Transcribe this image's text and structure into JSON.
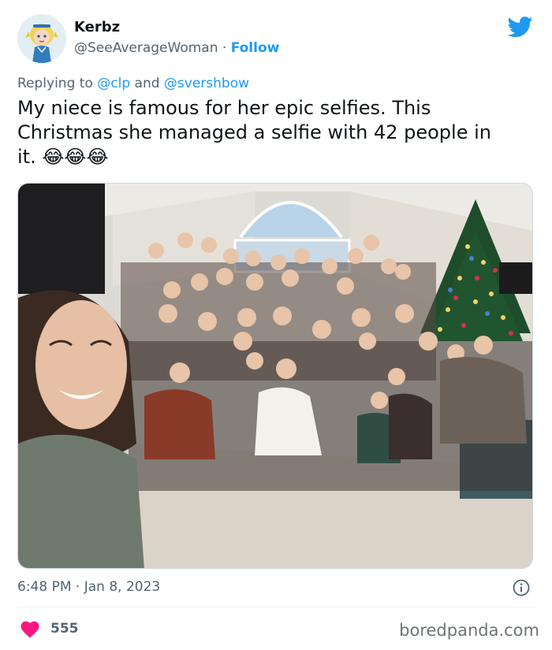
{
  "author": {
    "name": "Kerbz",
    "handle": "@SeeAverageWoman",
    "separator": "·",
    "follow_label": "Follow",
    "avatar_icon": "cartoon-girl-avatar-icon"
  },
  "reply": {
    "prefix": "Replying to",
    "mention1": "@clp",
    "conjunction": "and",
    "mention2": "@svershbow"
  },
  "tweet": {
    "line1": "My niece is famous for her epic selfies. This",
    "line2": "Christmas she managed a selfie with 42 people in",
    "line3": "it.",
    "emoji": "😂😂😂"
  },
  "photo": {
    "icon": "family-selfie-photo"
  },
  "meta": {
    "time": "6:48 PM",
    "separator": "·",
    "date": "Jan 8, 2023",
    "info_icon": "info-icon"
  },
  "engagement": {
    "likes": "555",
    "heart_icon": "heart-icon"
  },
  "watermark": "boredpanda.com",
  "colors": {
    "accent": "#1d9bf0",
    "heart": "#f91880",
    "muted": "#536471"
  }
}
